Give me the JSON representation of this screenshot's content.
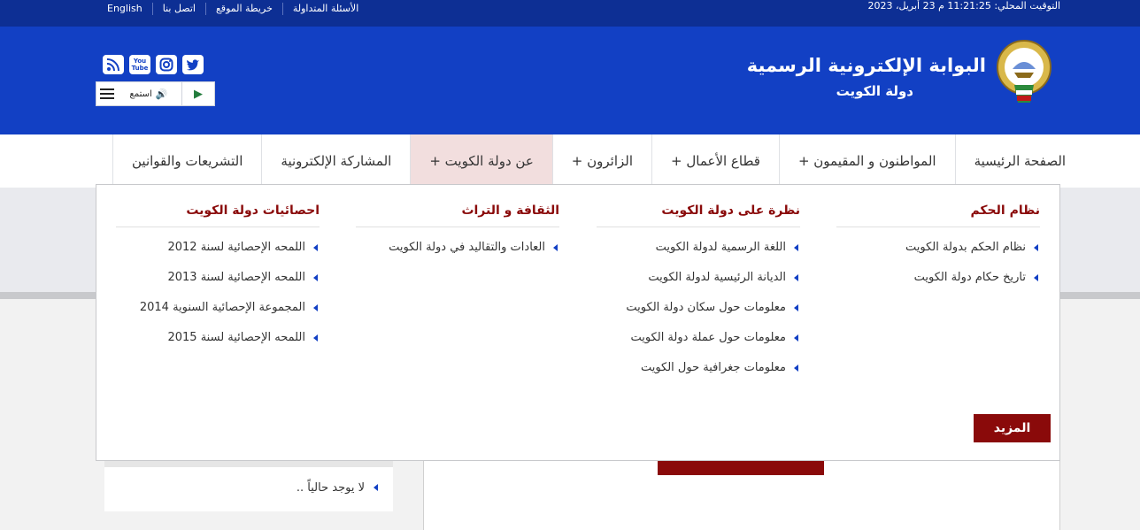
{
  "topbar": {
    "links": [
      "English",
      "اتصل بنا",
      "خريطة الموقع",
      "الأسئلة المتداولة"
    ],
    "clock": "التوقيت المحلي: 11:21:25 م 23 أبريل، 2023"
  },
  "header": {
    "title": "البوابة الإلكترونية الرسمية",
    "subtitle": "دولة  الكويت",
    "social_icons": [
      "rss-icon",
      "youtube-icon",
      "instagram-icon",
      "twitter-icon"
    ],
    "youtube_text": "You Tube",
    "player": {
      "listen_label": "استمع"
    }
  },
  "nav": {
    "items": [
      "الصفحة الرئيسية",
      "المواطنون و المقيمون +",
      "قطاع الأعمال +",
      "الزائرون +",
      "عن دولة الكويت +",
      "المشاركة الإلكترونية",
      "التشريعات والقوانين"
    ]
  },
  "dropdown": {
    "columns": [
      {
        "title": "نظام الحكم",
        "items": [
          "نظام الحكم بدولة الكويت",
          "تاريخ حكام دولة الكويت"
        ]
      },
      {
        "title": "نظرة على دولة الكويت",
        "items": [
          "اللغة الرسمية لدولة الكويت",
          "الديانة الرئيسية لدولة الكويت",
          "معلومات حول سكان دولة الكويت",
          "معلومات حول عملة دولة الكويت",
          "معلومات جغرافية حول الكويت"
        ]
      },
      {
        "title": "الثقافة و التراث",
        "items": [
          "العادات والتقاليد في دولة الكويت"
        ]
      },
      {
        "title": "احصائيات دولة الكويت",
        "items": [
          "اللمحه الإحصائية لسنة 2012",
          "اللمحه الإحصائية لسنة 2013",
          "المجموعة الإحصائية السنوية 2014",
          "اللمحه الإحصائية لسنة 2015"
        ]
      }
    ],
    "more_label": "المزيد"
  },
  "background": {
    "no_items_text": "لا يوجد حالياً .."
  },
  "colors": {
    "topbar": "#0d2f94",
    "header": "#1240c4",
    "accent_red": "#8a0a0a",
    "active_tab": "#f2dede"
  }
}
